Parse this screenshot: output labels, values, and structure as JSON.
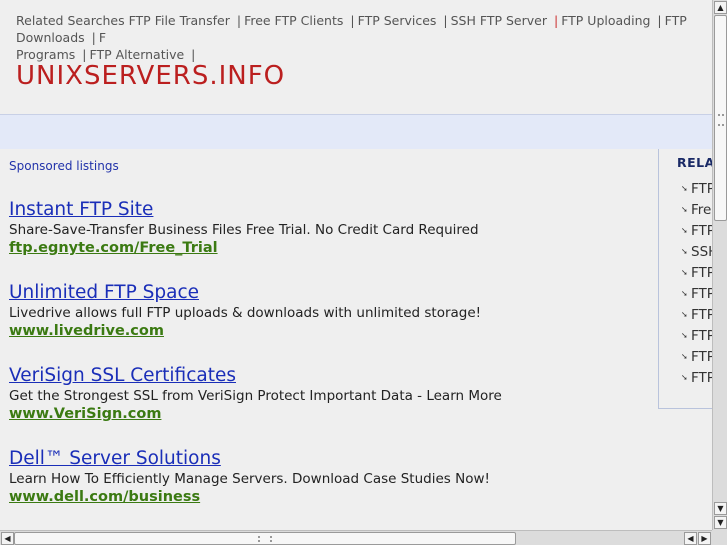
{
  "related_top": {
    "items": [
      "Related Searches",
      "FTP File Transfer",
      "Free FTP Clients",
      "FTP Services",
      "SSH FTP Server",
      "FTP Uploading",
      "FTP Downloads",
      "F",
      "Programs",
      "FTP Alternative"
    ]
  },
  "site_title": "UNIXSERVERS.INFO",
  "sponsored_label": "Sponsored listings",
  "ads": [
    {
      "title": "Instant FTP Site",
      "desc": "Share-Save-Transfer Business Files Free Trial. No Credit Card Required",
      "url": "ftp.egnyte.com/Free_Trial"
    },
    {
      "title": "Unlimited FTP Space",
      "desc": "Livedrive allows full FTP uploads & downloads with unlimited storage!",
      "url": "www.livedrive.com"
    },
    {
      "title": "VeriSign SSL Certificates",
      "desc": "Get the Strongest SSL from VeriSign Protect Important Data - Learn More",
      "url": "www.VeriSign.com"
    },
    {
      "title": "Dell™ Server Solutions",
      "desc": "Learn How To Efficiently Manage Servers. Download Case Studies Now!",
      "url": "www.dell.com/business"
    }
  ],
  "side": {
    "heading": "RELA",
    "items": [
      "FTP",
      "Fre",
      "FTP",
      "SSH",
      "FTP",
      "FTP",
      "FTP",
      "FTP",
      "FTP",
      "FTP"
    ]
  },
  "scrollbars": {
    "up": "▲",
    "down": "▼",
    "left": "◀",
    "right": "▶"
  }
}
